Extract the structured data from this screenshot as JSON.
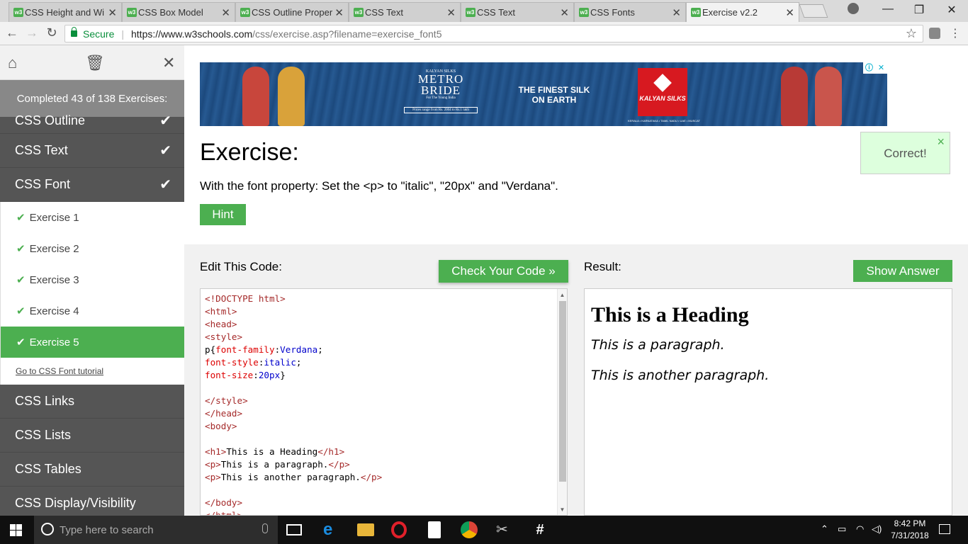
{
  "browser": {
    "tabs": [
      {
        "title": "CSS Height and Wi",
        "active": false
      },
      {
        "title": "CSS Box Model",
        "active": false
      },
      {
        "title": "CSS Outline Proper",
        "active": false
      },
      {
        "title": "CSS Text",
        "active": false
      },
      {
        "title": "CSS Text",
        "active": false
      },
      {
        "title": "CSS Fonts",
        "active": false
      },
      {
        "title": "Exercise v2.2",
        "active": true
      }
    ],
    "favicon_text": "w3",
    "secure_label": "Secure",
    "url_host": "https://www.w3schools.com",
    "url_path": "/css/exercise.asp?filename=exercise_font5"
  },
  "sidebar": {
    "progress": "Completed 43 of 138 Exercises:",
    "sections_before": [
      {
        "label": "CSS Outline",
        "completed": true
      },
      {
        "label": "CSS Text",
        "completed": true
      },
      {
        "label": "CSS Font",
        "completed": true
      }
    ],
    "exercises": [
      {
        "label": "Exercise 1",
        "active": false
      },
      {
        "label": "Exercise 2",
        "active": false
      },
      {
        "label": "Exercise 3",
        "active": false
      },
      {
        "label": "Exercise 4",
        "active": false
      },
      {
        "label": "Exercise 5",
        "active": true
      }
    ],
    "tutorial_link": "Go to CSS Font tutorial",
    "sections_after": [
      {
        "label": "CSS Links"
      },
      {
        "label": "CSS Lists"
      },
      {
        "label": "CSS Tables"
      },
      {
        "label": "CSS Display/Visibility"
      }
    ]
  },
  "ad": {
    "brand_top": "KALYAN SILKS",
    "brand_line1": "METRO",
    "brand_line2": "BRIDE",
    "brand_tag": "For The Young India",
    "brand_price": "Prices range from Rs. 2004 to Rs.1 lakh",
    "slogan": "THE FINEST SILK ON EARTH",
    "logo": "KALYAN SILKS",
    "locations": "KERALA • KARNATAKA • TAMIL NADU • UAE • MUSCAT"
  },
  "exercise": {
    "title": "Exercise:",
    "instructions": "With the font property: Set the <p> to \"italic\", \"20px\" and \"Verdana\".",
    "hint_label": "Hint",
    "correct_message": "Correct!"
  },
  "editor": {
    "label": "Edit This Code:",
    "check_label": "Check Your Code »",
    "lines": [
      [
        {
          "t": "tag",
          "s": "<!DOCTYPE html>"
        }
      ],
      [
        {
          "t": "tag",
          "s": "<html>"
        }
      ],
      [
        {
          "t": "tag",
          "s": "<head>"
        }
      ],
      [
        {
          "t": "tag",
          "s": "<style>"
        }
      ],
      [
        {
          "t": "txt",
          "s": "p{"
        },
        {
          "t": "prop",
          "s": "font-family"
        },
        {
          "t": "txt",
          "s": ":"
        },
        {
          "t": "val",
          "s": "Verdana"
        },
        {
          "t": "txt",
          "s": ";"
        }
      ],
      [
        {
          "t": "prop",
          "s": "font-style"
        },
        {
          "t": "txt",
          "s": ":"
        },
        {
          "t": "val",
          "s": "italic"
        },
        {
          "t": "txt",
          "s": ";"
        }
      ],
      [
        {
          "t": "prop",
          "s": "font-size"
        },
        {
          "t": "txt",
          "s": ":"
        },
        {
          "t": "val",
          "s": "20px"
        },
        {
          "t": "txt",
          "s": "}"
        }
      ],
      [],
      [
        {
          "t": "tag",
          "s": "</style>"
        }
      ],
      [
        {
          "t": "tag",
          "s": "</head>"
        }
      ],
      [
        {
          "t": "tag",
          "s": "<body>"
        }
      ],
      [],
      [
        {
          "t": "tag",
          "s": "<h1>"
        },
        {
          "t": "txt",
          "s": "This is a Heading"
        },
        {
          "t": "tag",
          "s": "</h1>"
        }
      ],
      [
        {
          "t": "tag",
          "s": "<p>"
        },
        {
          "t": "txt",
          "s": "This is a paragraph."
        },
        {
          "t": "tag",
          "s": "</p>"
        }
      ],
      [
        {
          "t": "tag",
          "s": "<p>"
        },
        {
          "t": "txt",
          "s": "This is another paragraph."
        },
        {
          "t": "tag",
          "s": "</p>"
        }
      ],
      [],
      [
        {
          "t": "tag",
          "s": "</body>"
        }
      ],
      [
        {
          "t": "tag",
          "s": "</html>"
        }
      ]
    ]
  },
  "result": {
    "label": "Result:",
    "answer_label": "Show Answer",
    "heading": "This is a Heading",
    "paragraph1": "This is a paragraph.",
    "paragraph2": "This is another paragraph."
  },
  "taskbar": {
    "search_placeholder": "Type here to search",
    "time": "8:42 PM",
    "date": "7/31/2018"
  },
  "colors": {
    "accent": "#4caf50",
    "sidebar": "#555555",
    "progress_bar": "#888888",
    "correct_bg": "#ddffdd"
  }
}
